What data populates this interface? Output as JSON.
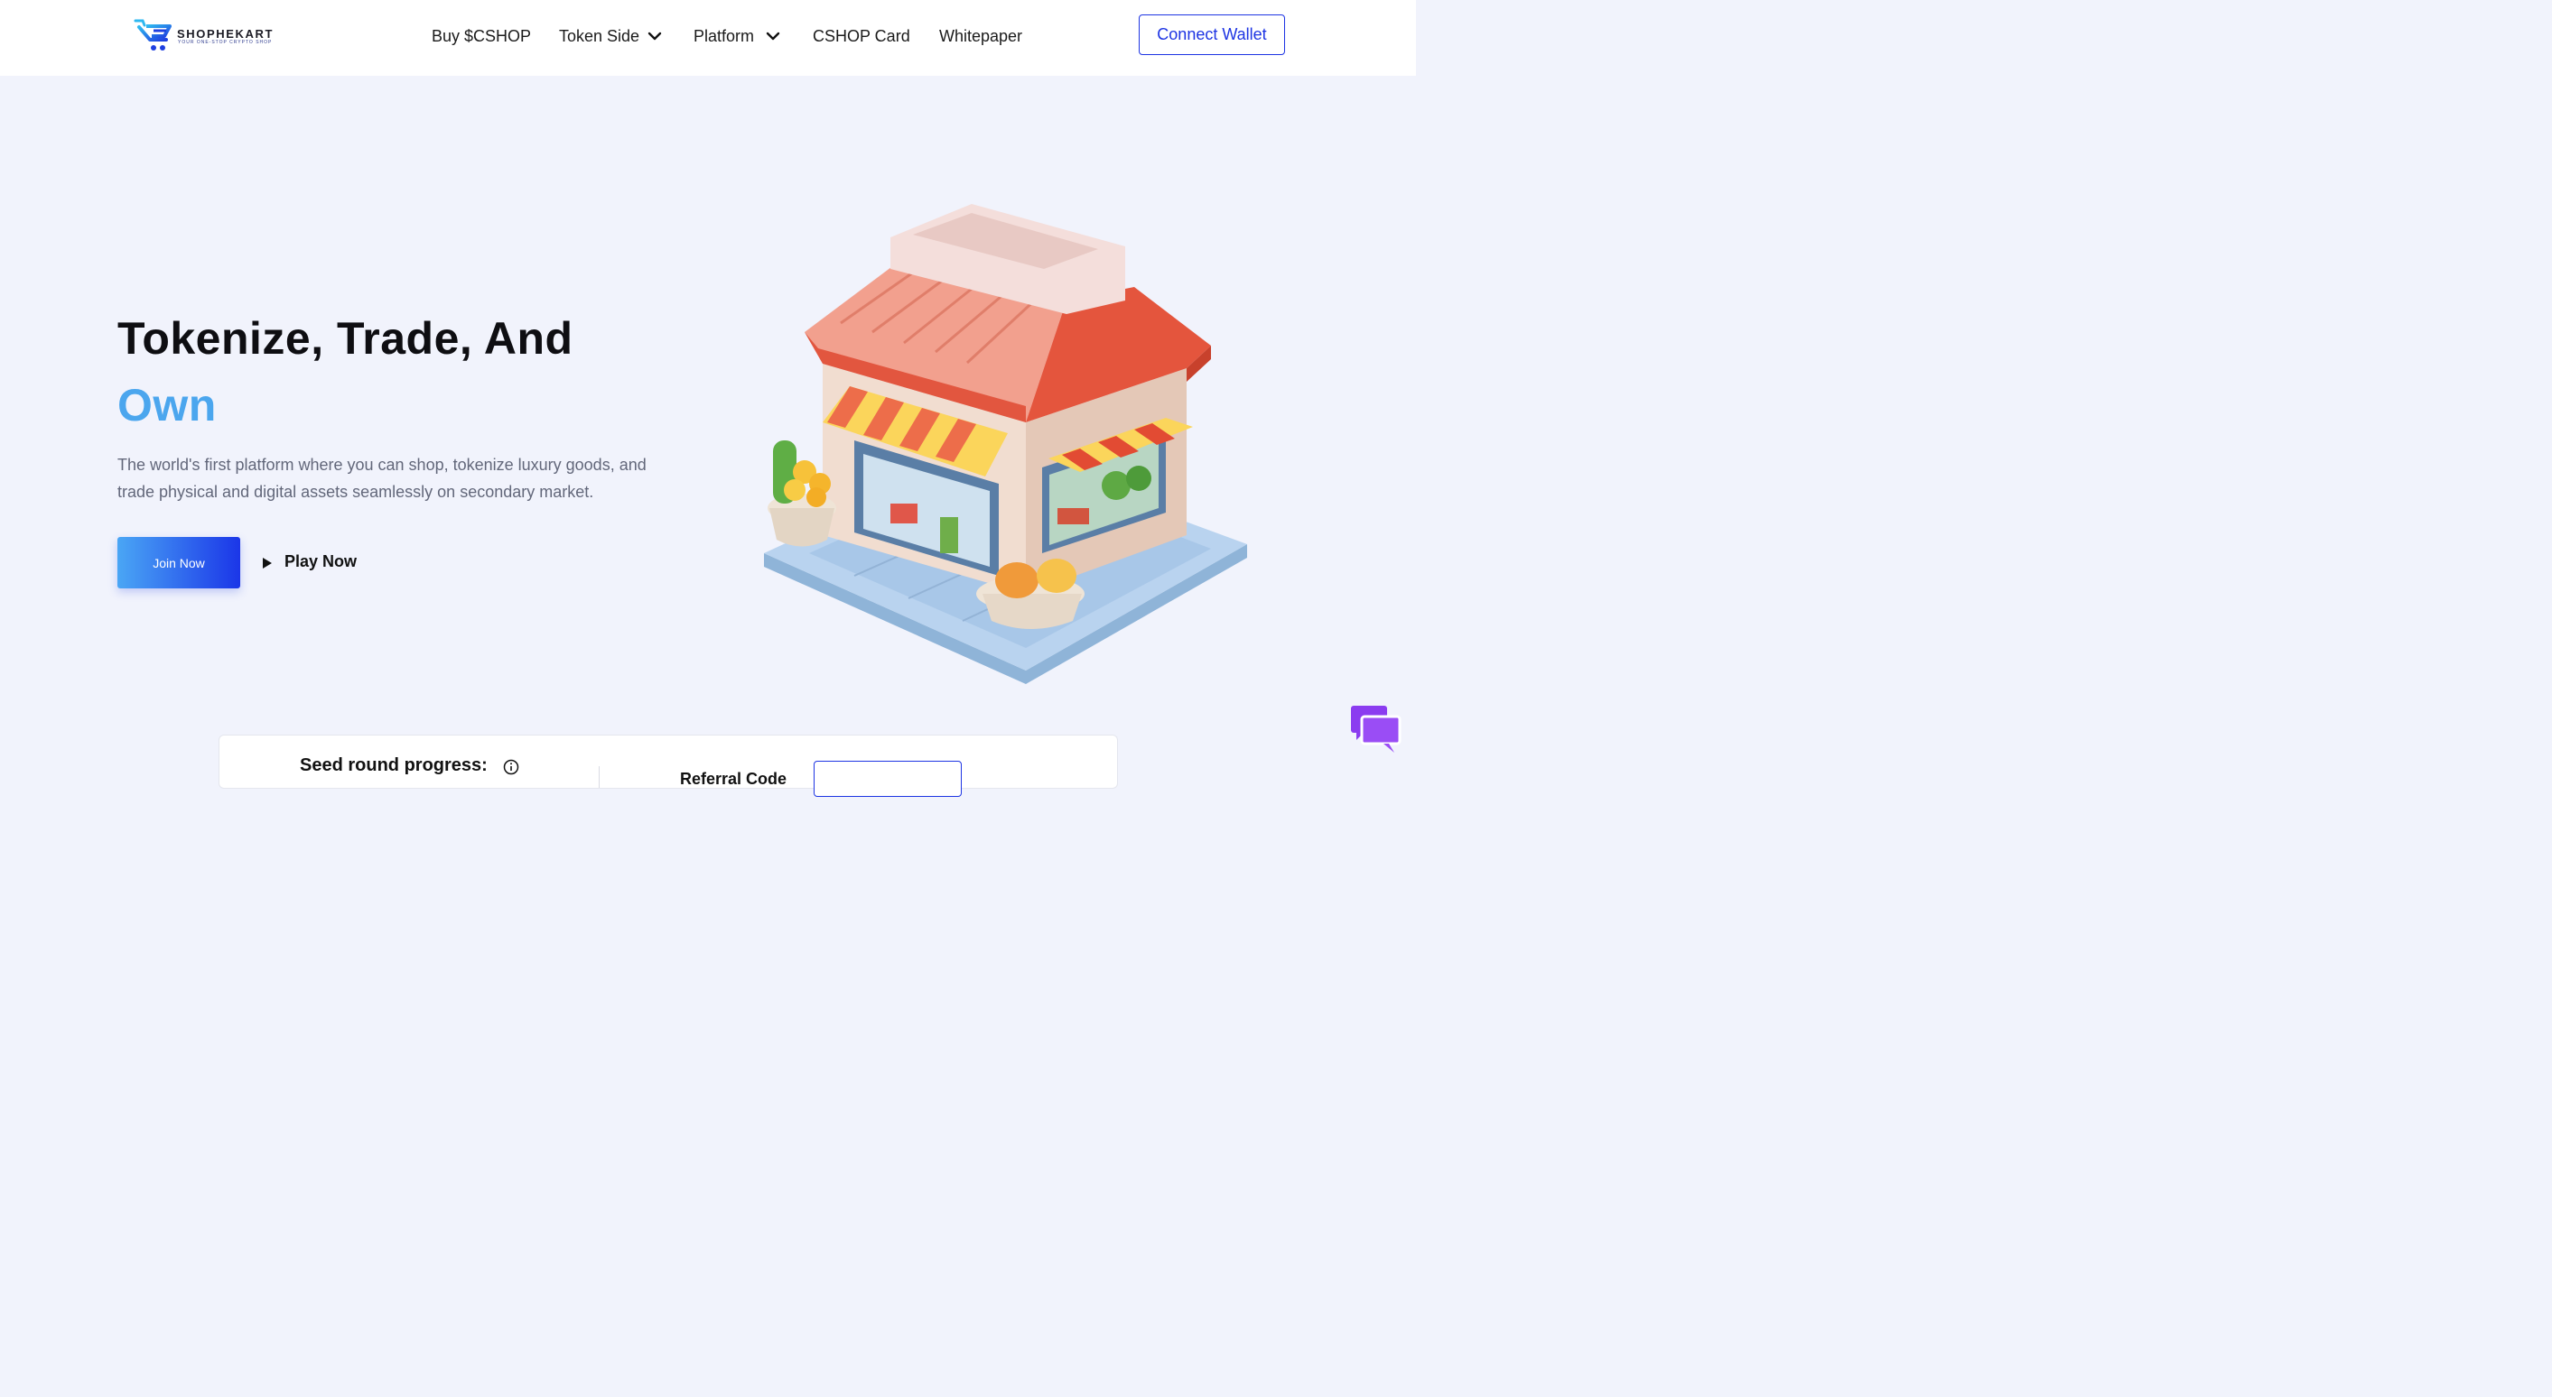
{
  "brand": {
    "name": "SHOPHEKART",
    "tagline": "YOUR ONE-STOP CRYPTO SHOP"
  },
  "nav": {
    "items": [
      {
        "label": "Buy $CSHOP",
        "has_dropdown": false
      },
      {
        "label": "Token Side",
        "has_dropdown": true
      },
      {
        "label": "Platform",
        "has_dropdown": true
      },
      {
        "label": "CSHOP Card",
        "has_dropdown": false
      },
      {
        "label": "Whitepaper",
        "has_dropdown": false
      }
    ],
    "connect_label": "Connect Wallet"
  },
  "hero": {
    "title_line1": "Tokenize, Trade, And",
    "title_accent": "Own",
    "description": "The world's first platform where you can shop, tokenize luxury goods, and trade physical and digital assets seamlessly on secondary market.",
    "primary_cta": "Join Now",
    "secondary_cta": "Play Now",
    "illustration_icon": "isometric-shop-illustration"
  },
  "seed": {
    "title": "Seed round progress:",
    "referral_label": "Referral Code"
  },
  "colors": {
    "accent_blue": "#1d34e3",
    "accent_light": "#4ba6ee",
    "page_bg": "#f1f3fc",
    "chat_purple": "#8b3cf0"
  },
  "icons": {
    "chat": "chat-bubbles-icon",
    "info": "info-icon",
    "play": "play-icon",
    "chevron": "chevron-down-icon"
  }
}
